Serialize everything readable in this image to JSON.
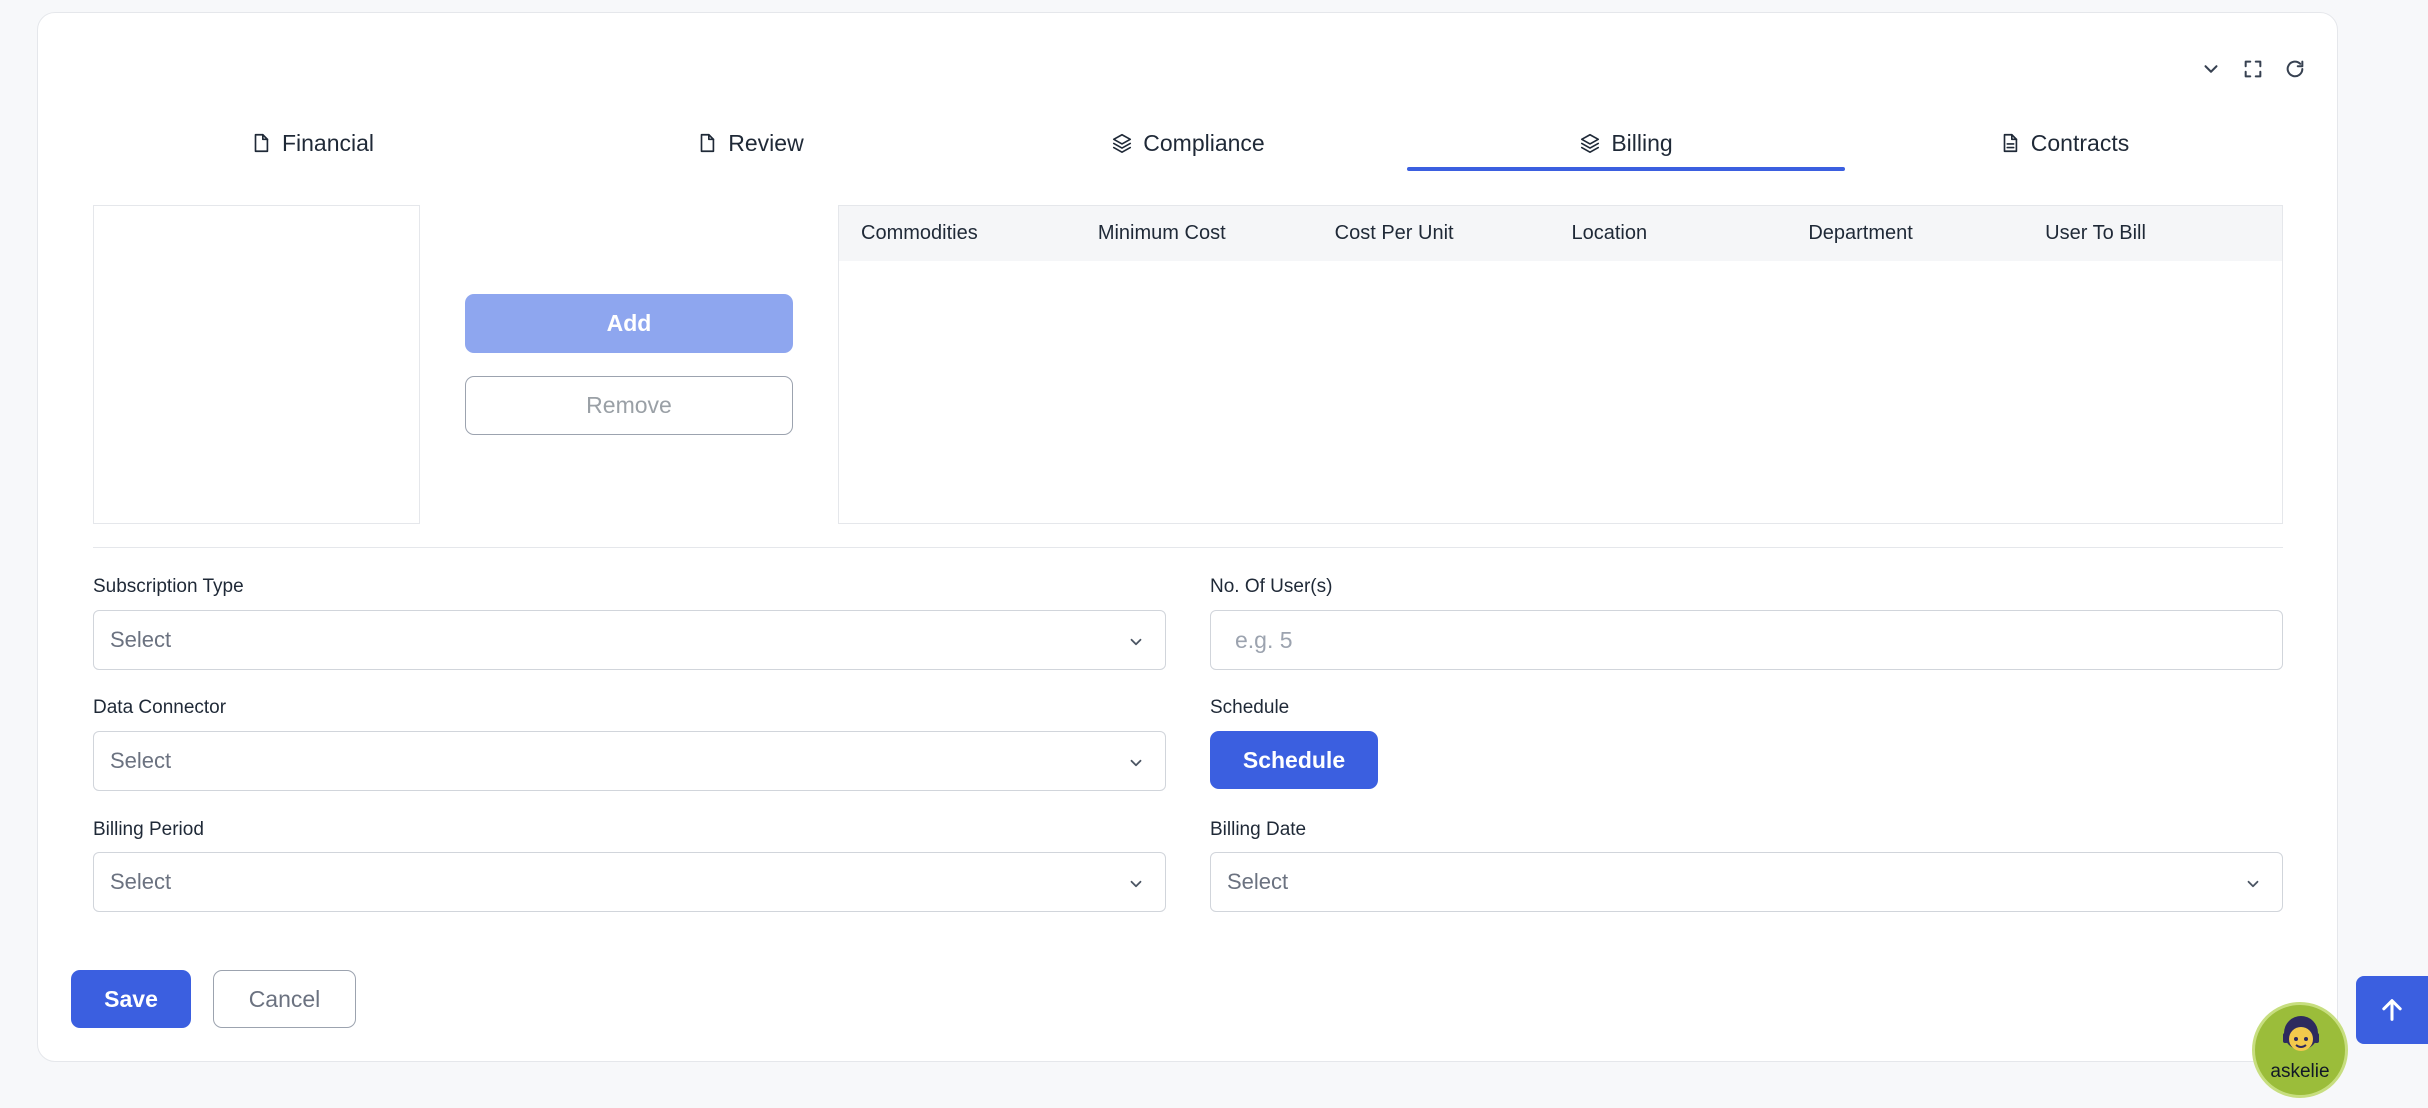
{
  "tabs": [
    {
      "label": "Financial",
      "icon": "file-icon",
      "active": false
    },
    {
      "label": "Review",
      "icon": "file-icon",
      "active": false
    },
    {
      "label": "Compliance",
      "icon": "layers-icon",
      "active": false
    },
    {
      "label": "Billing",
      "icon": "layers-icon",
      "active": true
    },
    {
      "label": "Contracts",
      "icon": "document-text-icon",
      "active": false
    }
  ],
  "transfer": {
    "add_label": "Add",
    "remove_label": "Remove"
  },
  "table": {
    "columns": [
      "Commodities",
      "Minimum Cost",
      "Cost Per Unit",
      "Location",
      "Department",
      "User To Bill"
    ],
    "rows": []
  },
  "form": {
    "subscription_type": {
      "label": "Subscription Type",
      "value": "Select"
    },
    "users": {
      "label": "No. Of User(s)",
      "placeholder": "e.g. 5"
    },
    "data_connector": {
      "label": "Data Connector",
      "value": "Select"
    },
    "schedule": {
      "label": "Schedule",
      "button_label": "Schedule"
    },
    "billing_period": {
      "label": "Billing Period",
      "value": "Select"
    },
    "billing_date": {
      "label": "Billing Date",
      "value": "Select"
    }
  },
  "actions": {
    "save_label": "Save",
    "cancel_label": "Cancel"
  },
  "assistant": {
    "name": "askelie"
  },
  "colors": {
    "accent": "#3b5fe0",
    "accent_disabled": "#8ea6ef",
    "assistant_bg": "#9bbd3a"
  }
}
